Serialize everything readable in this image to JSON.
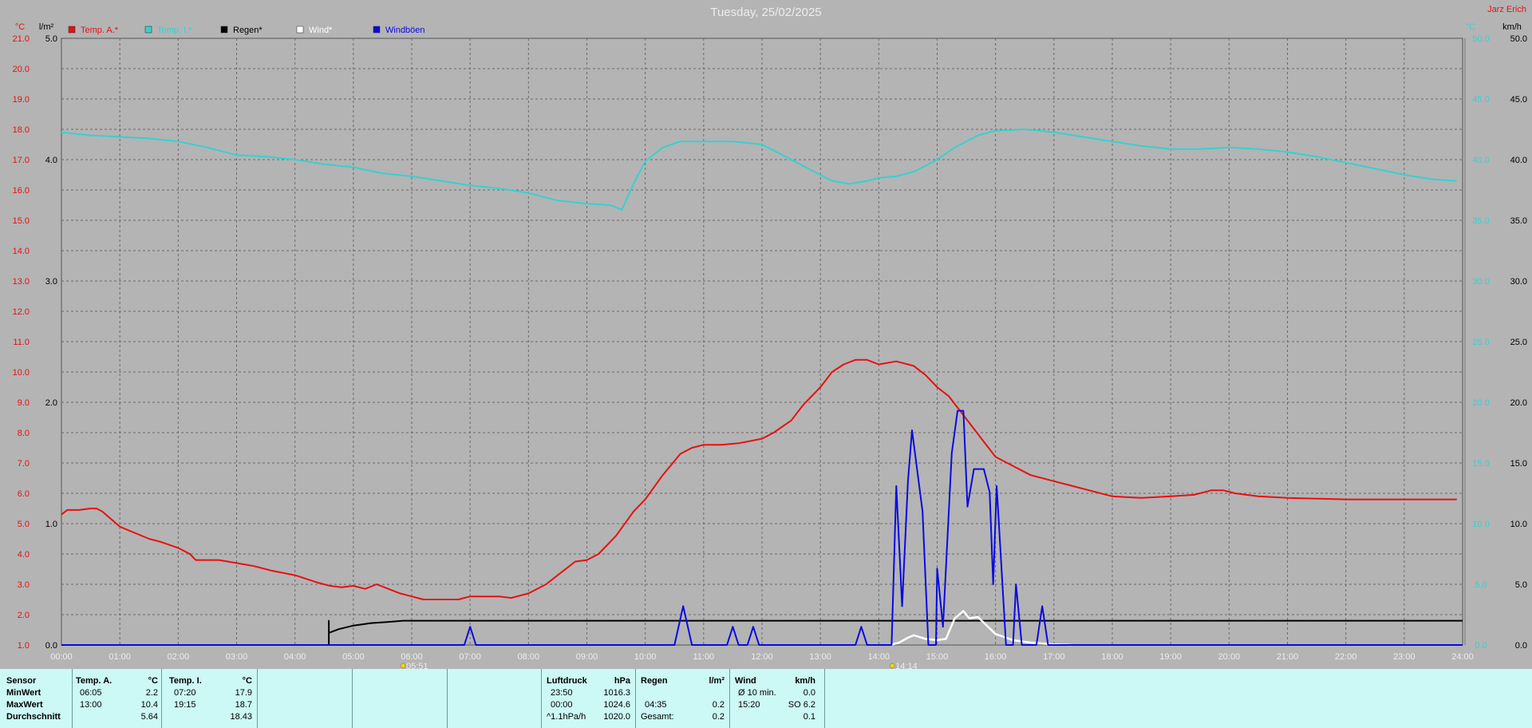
{
  "title": "Tuesday, 25/02/2025",
  "brand": "Jarz Erich",
  "colors": {
    "background": "#b4b4b4",
    "temp_a": "#e81010",
    "temp_i": "#38d0d0",
    "rain": "#000000",
    "wind": "#ffffff",
    "gusts": "#0a0ae0",
    "stats_bg": "#ccf8f5"
  },
  "chart_data": {
    "type": "line",
    "xlim": [
      0,
      24
    ],
    "x_ticks": [
      "00:00",
      "01:00",
      "02:00",
      "03:00",
      "04:00",
      "05:00",
      "06:00",
      "07:00",
      "08:00",
      "09:00",
      "10:00",
      "11:00",
      "12:00",
      "13:00",
      "14:00",
      "15:00",
      "16:00",
      "17:00",
      "18:00",
      "19:00",
      "20:00",
      "21:00",
      "22:00",
      "23:00",
      "24:00"
    ],
    "axes": {
      "temp": {
        "unit": "°C",
        "range": [
          1,
          21
        ],
        "ticks": [
          "1.0",
          "2.0",
          "3.0",
          "4.0",
          "5.0",
          "6.0",
          "7.0",
          "8.0",
          "9.0",
          "10.0",
          "11.0",
          "12.0",
          "13.0",
          "14.0",
          "15.0",
          "16.0",
          "17.0",
          "18.0",
          "19.0",
          "20.0",
          "21.0"
        ]
      },
      "rain": {
        "unit": "l/m²",
        "range": [
          0,
          5
        ],
        "ticks": [
          "0.0",
          "1.0",
          "2.0",
          "3.0",
          "4.0",
          "5.0"
        ]
      },
      "temp_i": {
        "unit": "°C",
        "range": [
          0,
          50
        ]
      },
      "wind": {
        "unit": "km/h",
        "range": [
          0,
          50
        ],
        "ticks": [
          "0.0",
          "5.0",
          "10.0",
          "15.0",
          "20.0",
          "25.0",
          "30.0",
          "35.0",
          "40.0",
          "45.0",
          "50.0"
        ]
      }
    },
    "legend": [
      {
        "name": "Temp. A.*",
        "color": "#e81010"
      },
      {
        "name": "Temp. I.*",
        "color": "#38d0d0"
      },
      {
        "name": "Regen*",
        "color": "#000000"
      },
      {
        "name": "Wind*",
        "color": "#ffffff"
      },
      {
        "name": "Windböen",
        "color": "#0a0ae0"
      }
    ],
    "markers": [
      {
        "x": 5.85,
        "label": "05:51"
      },
      {
        "x": 14.23,
        "label": "14:14"
      }
    ],
    "series": [
      {
        "name": "Temp. A.*",
        "axis": "temp",
        "color": "#e81010",
        "points": [
          [
            0,
            5.3
          ],
          [
            0.1,
            5.45
          ],
          [
            0.3,
            5.45
          ],
          [
            0.5,
            5.5
          ],
          [
            0.6,
            5.5
          ],
          [
            0.7,
            5.4
          ],
          [
            1,
            4.9
          ],
          [
            1.5,
            4.5
          ],
          [
            1.7,
            4.4
          ],
          [
            2,
            4.2
          ],
          [
            2.2,
            4.0
          ],
          [
            2.3,
            3.8
          ],
          [
            2.7,
            3.8
          ],
          [
            3,
            3.7
          ],
          [
            3.3,
            3.6
          ],
          [
            3.6,
            3.45
          ],
          [
            4,
            3.3
          ],
          [
            4.4,
            3.05
          ],
          [
            4.6,
            2.95
          ],
          [
            4.8,
            2.9
          ],
          [
            5,
            2.95
          ],
          [
            5.2,
            2.85
          ],
          [
            5.4,
            3.0
          ],
          [
            5.6,
            2.85
          ],
          [
            5.8,
            2.7
          ],
          [
            6,
            2.6
          ],
          [
            6.2,
            2.5
          ],
          [
            6.5,
            2.5
          ],
          [
            6.8,
            2.5
          ],
          [
            7,
            2.6
          ],
          [
            7.3,
            2.6
          ],
          [
            7.5,
            2.6
          ],
          [
            7.7,
            2.55
          ],
          [
            8,
            2.7
          ],
          [
            8.3,
            3.0
          ],
          [
            8.6,
            3.45
          ],
          [
            8.8,
            3.75
          ],
          [
            9,
            3.8
          ],
          [
            9.2,
            4.0
          ],
          [
            9.5,
            4.6
          ],
          [
            9.8,
            5.4
          ],
          [
            10,
            5.8
          ],
          [
            10.3,
            6.6
          ],
          [
            10.6,
            7.3
          ],
          [
            10.8,
            7.5
          ],
          [
            11,
            7.6
          ],
          [
            11.3,
            7.6
          ],
          [
            11.6,
            7.65
          ],
          [
            12,
            7.8
          ],
          [
            12.2,
            8.0
          ],
          [
            12.5,
            8.4
          ],
          [
            12.7,
            8.9
          ],
          [
            13,
            9.5
          ],
          [
            13.2,
            10.0
          ],
          [
            13.4,
            10.25
          ],
          [
            13.6,
            10.4
          ],
          [
            13.8,
            10.4
          ],
          [
            14,
            10.25
          ],
          [
            14.3,
            10.35
          ],
          [
            14.6,
            10.2
          ],
          [
            14.8,
            9.9
          ],
          [
            15,
            9.5
          ],
          [
            15.2,
            9.2
          ],
          [
            15.4,
            8.7
          ],
          [
            15.6,
            8.2
          ],
          [
            15.8,
            7.7
          ],
          [
            16,
            7.2
          ],
          [
            16.3,
            6.9
          ],
          [
            16.6,
            6.6
          ],
          [
            17,
            6.4
          ],
          [
            17.3,
            6.25
          ],
          [
            17.6,
            6.1
          ],
          [
            18,
            5.9
          ],
          [
            18.5,
            5.85
          ],
          [
            19,
            5.9
          ],
          [
            19.4,
            5.95
          ],
          [
            19.7,
            6.1
          ],
          [
            19.9,
            6.1
          ],
          [
            20.1,
            6.0
          ],
          [
            20.5,
            5.9
          ],
          [
            21,
            5.85
          ],
          [
            22,
            5.8
          ],
          [
            23,
            5.8
          ],
          [
            23.9,
            5.8
          ]
        ]
      },
      {
        "name": "Temp. I.*",
        "axis": "temp",
        "color": "#38d0d0",
        "points": [
          [
            0,
            17.9
          ],
          [
            0.5,
            17.8
          ],
          [
            1,
            17.75
          ],
          [
            1.5,
            17.7
          ],
          [
            2,
            17.6
          ],
          [
            2.5,
            17.4
          ],
          [
            3,
            17.15
          ],
          [
            3.5,
            17.1
          ],
          [
            4,
            17.0
          ],
          [
            4.5,
            16.85
          ],
          [
            5,
            16.75
          ],
          [
            5.5,
            16.55
          ],
          [
            6,
            16.45
          ],
          [
            6.5,
            16.3
          ],
          [
            7,
            16.15
          ],
          [
            7.5,
            16.05
          ],
          [
            8,
            15.9
          ],
          [
            8.5,
            15.65
          ],
          [
            9,
            15.55
          ],
          [
            9.4,
            15.5
          ],
          [
            9.6,
            15.35
          ],
          [
            9.8,
            16.2
          ],
          [
            10,
            16.95
          ],
          [
            10.3,
            17.4
          ],
          [
            10.6,
            17.6
          ],
          [
            11,
            17.6
          ],
          [
            11.5,
            17.6
          ],
          [
            12,
            17.5
          ],
          [
            12.4,
            17.1
          ],
          [
            12.8,
            16.7
          ],
          [
            13.2,
            16.3
          ],
          [
            13.5,
            16.2
          ],
          [
            13.8,
            16.3
          ],
          [
            14,
            16.4
          ],
          [
            14.3,
            16.45
          ],
          [
            14.6,
            16.6
          ],
          [
            15,
            17.0
          ],
          [
            15.3,
            17.4
          ],
          [
            15.7,
            17.8
          ],
          [
            16,
            17.95
          ],
          [
            16.5,
            18.0
          ],
          [
            17,
            17.9
          ],
          [
            17.5,
            17.75
          ],
          [
            18,
            17.6
          ],
          [
            18.5,
            17.45
          ],
          [
            19,
            17.35
          ],
          [
            19.5,
            17.35
          ],
          [
            20,
            17.4
          ],
          [
            20.5,
            17.35
          ],
          [
            21,
            17.25
          ],
          [
            21.5,
            17.1
          ],
          [
            22,
            16.9
          ],
          [
            22.5,
            16.7
          ],
          [
            23,
            16.5
          ],
          [
            23.5,
            16.35
          ],
          [
            23.9,
            16.3
          ]
        ]
      },
      {
        "name": "Regen*",
        "axis": "rain",
        "color": "#000000",
        "points": [
          [
            4.58,
            0
          ],
          [
            4.58,
            0.2
          ],
          [
            4.58,
            0.1
          ],
          [
            4.75,
            0.13
          ],
          [
            5.0,
            0.16
          ],
          [
            5.3,
            0.18
          ],
          [
            5.6,
            0.19
          ],
          [
            5.85,
            0.2
          ],
          [
            24,
            0.2
          ]
        ]
      },
      {
        "name": "Wind*",
        "axis": "wind",
        "color": "#ffffff",
        "points": [
          [
            14.2,
            0
          ],
          [
            14.35,
            0.2
          ],
          [
            14.5,
            0.6
          ],
          [
            14.6,
            0.8
          ],
          [
            14.8,
            0.5
          ],
          [
            15.0,
            0.4
          ],
          [
            15.15,
            0.5
          ],
          [
            15.3,
            2.2
          ],
          [
            15.45,
            2.8
          ],
          [
            15.55,
            2.2
          ],
          [
            15.7,
            2.3
          ],
          [
            15.85,
            1.6
          ],
          [
            16.0,
            0.9
          ],
          [
            16.3,
            0.4
          ],
          [
            16.6,
            0.2
          ],
          [
            17,
            0.05
          ],
          [
            17.3,
            0
          ]
        ]
      },
      {
        "name": "Windböen",
        "axis": "wind",
        "color": "#0a0ae0",
        "points": [
          [
            0,
            0
          ],
          [
            6.9,
            0
          ],
          [
            7.0,
            1.5
          ],
          [
            7.1,
            0
          ],
          [
            10.5,
            0
          ],
          [
            10.65,
            3.2
          ],
          [
            10.8,
            0
          ],
          [
            11.4,
            0
          ],
          [
            11.5,
            1.5
          ],
          [
            11.6,
            0
          ],
          [
            11.75,
            0
          ],
          [
            11.85,
            1.5
          ],
          [
            11.95,
            0
          ],
          [
            13.6,
            0
          ],
          [
            13.7,
            1.5
          ],
          [
            13.8,
            0
          ],
          [
            14.22,
            0
          ],
          [
            14.3,
            13.1
          ],
          [
            14.4,
            3.2
          ],
          [
            14.5,
            13.5
          ],
          [
            14.57,
            17.7
          ],
          [
            14.75,
            11.0
          ],
          [
            14.85,
            0
          ],
          [
            14.98,
            0
          ],
          [
            15.0,
            6.3
          ],
          [
            15.1,
            1.5
          ],
          [
            15.25,
            15.8
          ],
          [
            15.35,
            19.3
          ],
          [
            15.45,
            19.3
          ],
          [
            15.52,
            11.4
          ],
          [
            15.63,
            14.5
          ],
          [
            15.8,
            14.5
          ],
          [
            15.9,
            12.6
          ],
          [
            15.96,
            5.0
          ],
          [
            16.02,
            13.1
          ],
          [
            16.18,
            0
          ],
          [
            16.3,
            0
          ],
          [
            16.35,
            5.0
          ],
          [
            16.45,
            0
          ],
          [
            16.7,
            0
          ],
          [
            16.8,
            3.2
          ],
          [
            16.9,
            0
          ],
          [
            24,
            0
          ]
        ]
      }
    ]
  },
  "stats": {
    "headers": {
      "sensor": "Sensor",
      "temp_a": "Temp. A.",
      "temp_a_unit": "°C",
      "temp_i": "Temp. I.",
      "temp_i_unit": "°C",
      "pressure": "Luftdruck",
      "pressure_unit": "hPa",
      "rain": "Regen",
      "rain_unit": "l/m²",
      "wind": "Wind",
      "wind_unit": "km/h"
    },
    "rows": [
      {
        "label": "MinWert",
        "ta_time": "06:05",
        "ta_val": "2.2",
        "ti_time": "07:20",
        "ti_val": "17.9",
        "p_time": "23:50",
        "p_val": "1016.3",
        "r_time": "",
        "r_val": "",
        "w_time": "Ø 10 min.",
        "w_val": "0.0"
      },
      {
        "label": "MaxWert",
        "ta_time": "13:00",
        "ta_val": "10.4",
        "ti_time": "19:15",
        "ti_val": "18.7",
        "p_time": "00:00",
        "p_val": "1024.6",
        "r_time": "04:35",
        "r_val": "0.2",
        "w_time": "15:20",
        "w_val": "SO 6.2"
      },
      {
        "label": "Durchschnitt",
        "ta_time": "",
        "ta_val": "5.64",
        "ti_time": "",
        "ti_val": "18.43",
        "p_time": "^1.1hPa/h",
        "p_val": "1020.0",
        "r_time": "Gesamt:",
        "r_val": "0.2",
        "w_time": "",
        "w_val": "0.1"
      }
    ]
  }
}
